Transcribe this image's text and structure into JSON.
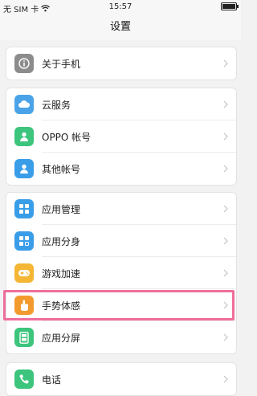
{
  "status_bar": {
    "carrier": "无 SIM 卡",
    "time": "15:57",
    "battery_level": 1.0
  },
  "page": {
    "title": "设置"
  },
  "groups": [
    {
      "items": [
        {
          "label": "关于手机",
          "icon": "info-icon",
          "color": "#8c8c8c"
        }
      ]
    },
    {
      "items": [
        {
          "label": "云服务",
          "icon": "cloud-icon",
          "color": "#4aa3e8"
        },
        {
          "label": "OPPO 帐号",
          "icon": "account-icon",
          "color": "#3dc47d"
        },
        {
          "label": "其他帐号",
          "icon": "other-account-icon",
          "color": "#3a9de8"
        }
      ]
    },
    {
      "items": [
        {
          "label": "应用管理",
          "icon": "app-management-icon",
          "color": "#3a9de8"
        },
        {
          "label": "应用分身",
          "icon": "app-clone-icon",
          "color": "#3a9de8"
        },
        {
          "label": "游戏加速",
          "icon": "game-accel-icon",
          "color": "#f4b634"
        },
        {
          "label": "手势体感",
          "icon": "gesture-icon",
          "color": "#f39a2e"
        },
        {
          "label": "应用分屏",
          "icon": "split-screen-icon",
          "color": "#3dc47d"
        }
      ]
    },
    {
      "items": [
        {
          "label": "电话",
          "icon": "phone-icon",
          "color": "#3dc47d"
        }
      ]
    }
  ],
  "highlighted_item": "手势体感",
  "highlight_color": "#ee6e9c"
}
